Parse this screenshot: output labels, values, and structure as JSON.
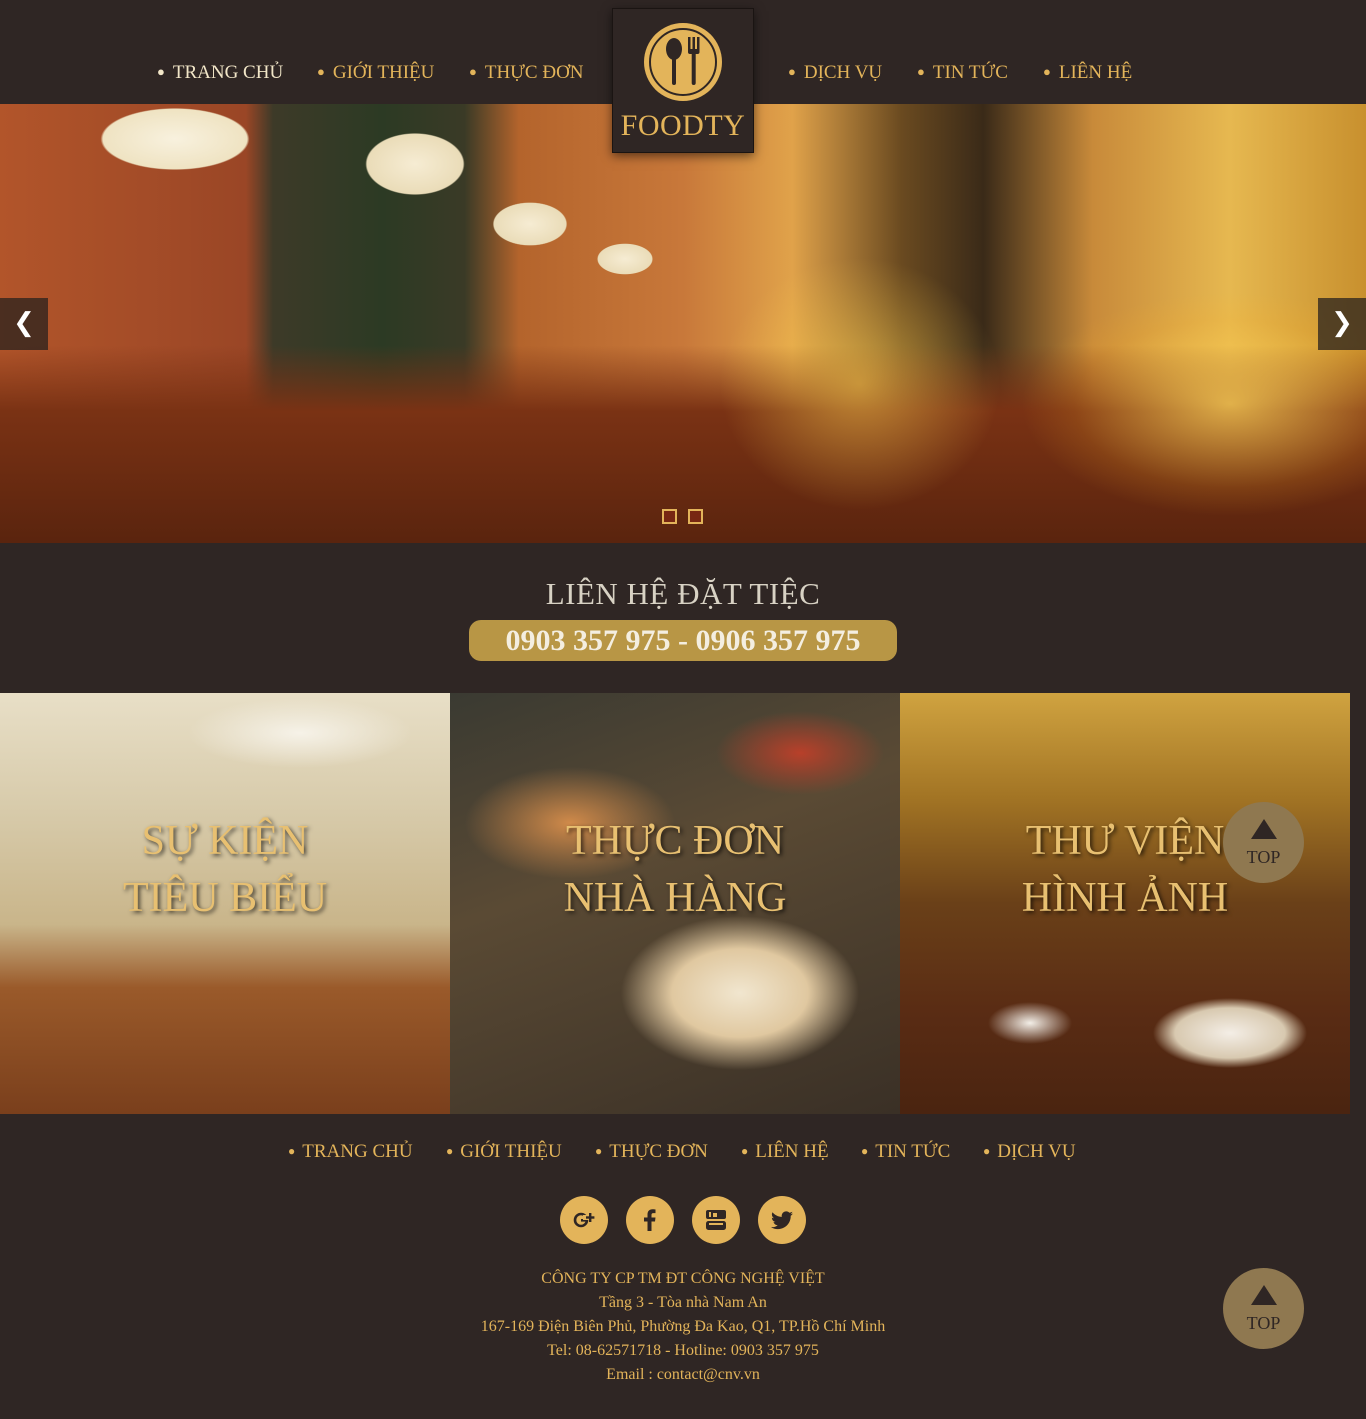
{
  "header": {
    "nav_left": [
      "TRANG CHỦ",
      "GIỚI THIỆU",
      "THỰC ĐƠN"
    ],
    "nav_right": [
      "DỊCH VỤ",
      "TIN TỨC",
      "LIÊN HỆ"
    ],
    "logo_text": "FOODTY"
  },
  "slider": {
    "prev_icon": "chevron-left-icon",
    "next_icon": "chevron-right-icon",
    "prev_glyph": "❮",
    "next_glyph": "❯",
    "slide_count": 2
  },
  "contact": {
    "title": "LIÊN HỆ ĐẶT TIỆC",
    "phones": "0903 357 975 - 0906 357 975"
  },
  "features": [
    {
      "line1": "SỰ KIỆN",
      "line2": "TIÊU BIỂU"
    },
    {
      "line1": "THỰC ĐƠN",
      "line2": "NHÀ HÀNG"
    },
    {
      "line1": "THƯ VIỆN",
      "line2": "HÌNH ẢNH"
    }
  ],
  "top_button": {
    "label": "TOP"
  },
  "footer": {
    "nav": [
      "TRANG CHỦ",
      "GIỚI THIỆU",
      "THỰC ĐƠN",
      "LIÊN HỆ",
      "TIN TỨC",
      "DỊCH VỤ"
    ],
    "social": [
      "google-plus-icon",
      "facebook-icon",
      "youtube-icon",
      "twitter-icon"
    ],
    "company": "CÔNG TY CP TM ĐT CÔNG NGHỆ VIỆT",
    "floor": "Tầng 3 - Tòa nhà Nam An",
    "address": "167-169 Điện Biên Phủ, Phường Đa Kao, Q1, TP.Hồ Chí Minh",
    "phone": "Tel: 08-62571718 - Hotline: 0903 357 975",
    "email": "Email : contact@cnv.vn"
  },
  "colors": {
    "background": "#2f2624",
    "accent": "#e3b45a",
    "pill": "#b89645"
  }
}
